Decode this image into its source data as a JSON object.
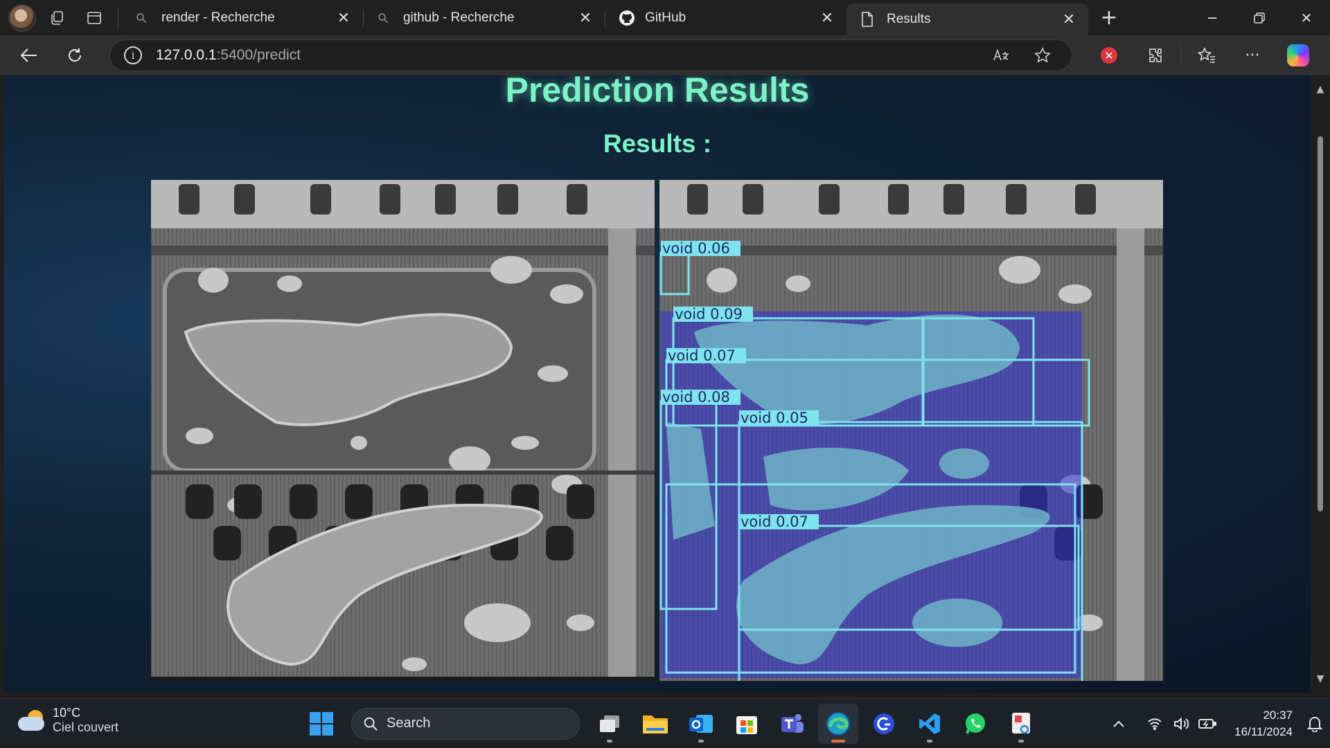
{
  "browser": {
    "tabs": [
      {
        "label": "render - Recherche",
        "icon": "search-icon"
      },
      {
        "label": "github - Recherche",
        "icon": "search-icon"
      },
      {
        "label": "GitHub",
        "icon": "github-icon"
      },
      {
        "label": "Results",
        "icon": "page-icon",
        "active": true
      }
    ],
    "url_host": "127.0.0.1",
    "url_path": ":5400/predict"
  },
  "page": {
    "title": "Prediction Results",
    "subtitle": "Results :",
    "accent_color": "#7cf3c6",
    "original_image_alt": "X-ray of circuit board",
    "prediction_image_alt": "X-ray with void detections",
    "detections": [
      {
        "label": "void",
        "score": "0.06",
        "text": "void 0.06"
      },
      {
        "label": "void",
        "score": "0.09",
        "text": "void 0.09"
      },
      {
        "label": "void",
        "score": "0.07",
        "text": "void 0.07"
      },
      {
        "label": "void",
        "score": "0.08",
        "text": "void 0.08"
      },
      {
        "label": "void",
        "score": "0.05",
        "text": "void 0.05"
      },
      {
        "label": "void",
        "score": "0.07",
        "text": "void 0.07"
      }
    ],
    "box_color": "#7fe3ee",
    "mask_color": "#2f2fd8"
  },
  "taskbar": {
    "weather_temp": "10°C",
    "weather_desc": "Ciel couvert",
    "search_label": "Search",
    "time": "20:37",
    "date": "16/11/2024"
  }
}
